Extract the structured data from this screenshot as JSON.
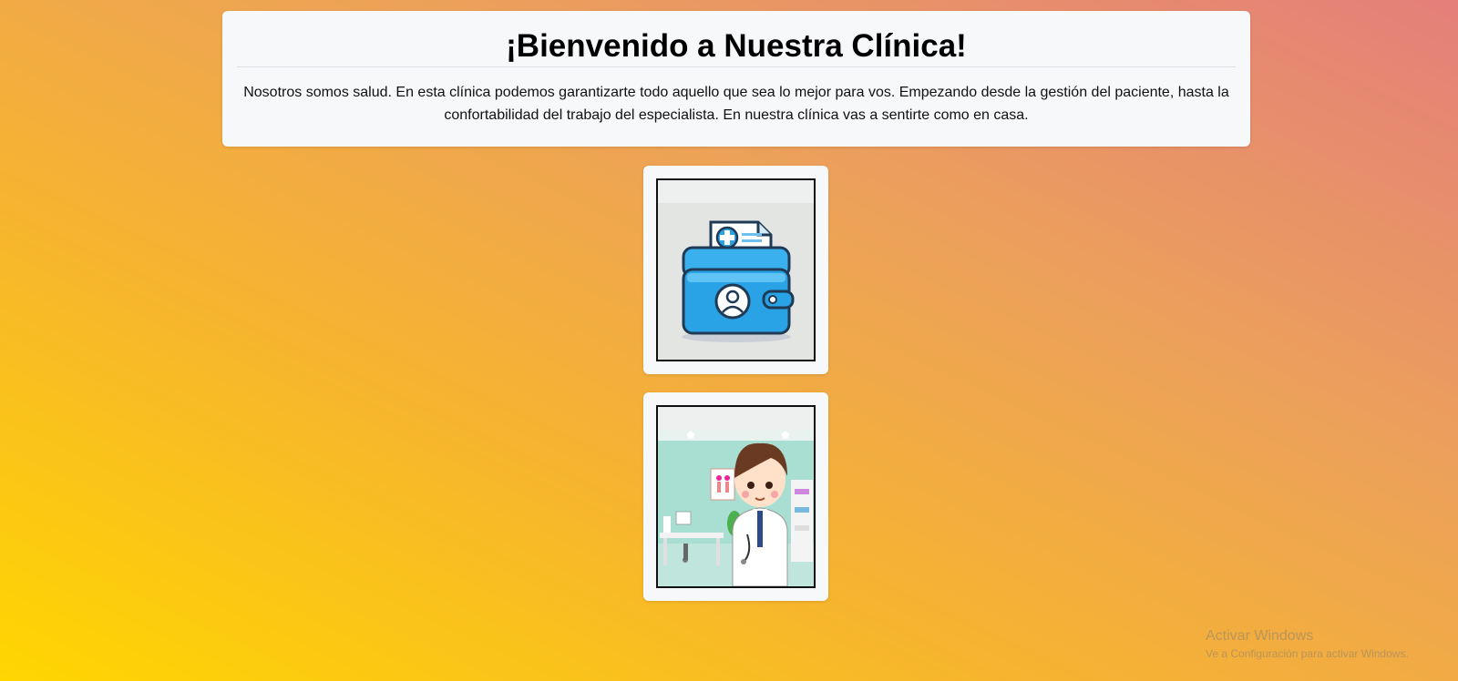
{
  "header": {
    "title": "¡Bienvenido a Nuestra Clínica!",
    "description": "Nosotros somos salud. En esta clínica podemos garantizarte todo aquello que sea lo mejor para vos. Empezando desde la gestión del paciente, hasta la confortabilidad del trabajo del especialista. En nuestra clínica vas a sentirte como en casa."
  },
  "cards": [
    {
      "icon": "patient-record-wallet-icon"
    },
    {
      "icon": "doctor-illustration"
    }
  ],
  "watermark": {
    "title": "Activar Windows",
    "subtitle": "Ve a Configuración para activar Windows."
  },
  "colors": {
    "background_start": "#ffd600",
    "background_end": "#e47f7a",
    "card": "#f7f8fa",
    "icon_blue": "#2aa3e6"
  }
}
